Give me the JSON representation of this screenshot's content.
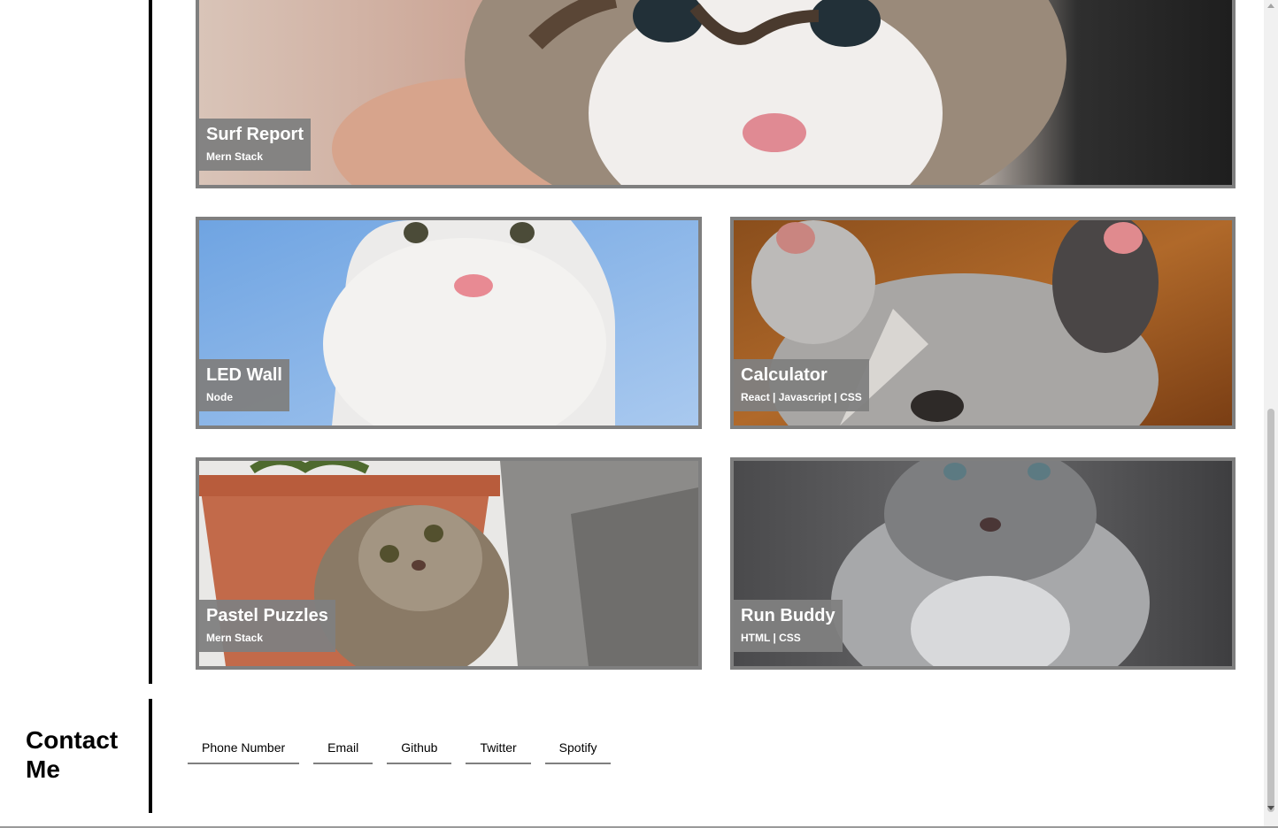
{
  "projects": [
    {
      "id": "surf",
      "title": "Surf Report",
      "tech": "Mern Stack"
    },
    {
      "id": "led",
      "title": "LED Wall",
      "tech": "Node"
    },
    {
      "id": "calc",
      "title": "Calculator",
      "tech": "React | Javascript | CSS"
    },
    {
      "id": "pastel",
      "title": "Pastel Puzzles",
      "tech": "Mern Stack"
    },
    {
      "id": "run",
      "title": "Run Buddy",
      "tech": "HTML | CSS"
    }
  ],
  "contact": {
    "heading": "Contact Me",
    "links": [
      "Phone Number",
      "Email",
      "Github",
      "Twitter",
      "Spotify"
    ]
  },
  "colors": {
    "card_border": "#7f7f7f",
    "label_bg": "#808080",
    "divider": "#000000"
  },
  "icons": {
    "scroll_up": "triangle-up",
    "scroll_down": "triangle-down"
  },
  "scroll": {
    "position_fraction": 1.0
  }
}
